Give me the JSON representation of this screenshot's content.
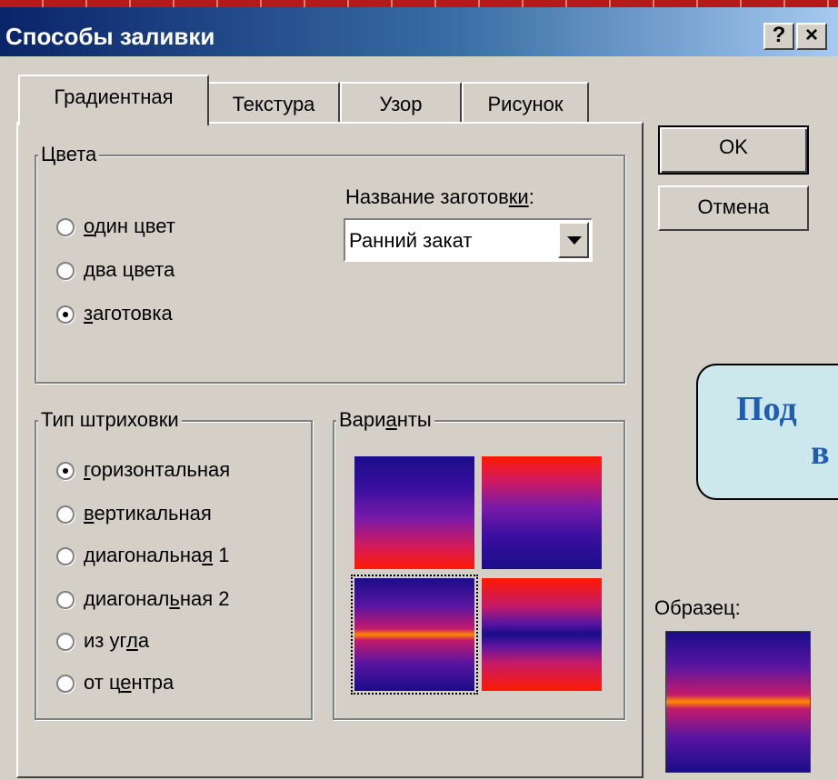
{
  "window": {
    "title": "Способы заливки",
    "help_label": "?",
    "close_label": "×"
  },
  "tabs": [
    {
      "label": "Градиентная",
      "active": true
    },
    {
      "label": "Текстура",
      "active": false
    },
    {
      "label": "Узор",
      "active": false
    },
    {
      "label": "Рисунок",
      "active": false
    }
  ],
  "colors_group": {
    "legend": "Цвета",
    "options": [
      {
        "pre": "",
        "u": "о",
        "post": "дин цвет",
        "checked": false
      },
      {
        "pre": "",
        "u": "д",
        "post": "ва цвета",
        "checked": false
      },
      {
        "pre": "",
        "u": "з",
        "post": "аготовка",
        "checked": true
      }
    ],
    "preset_label_pre": "Название заготов",
    "preset_label_u": "ки",
    "preset_label_post": ":",
    "preset_value": "Ранний закат"
  },
  "hatch_group": {
    "legend": "Тип штриховки",
    "options": [
      {
        "pre": "",
        "u": "г",
        "post": "оризонтальная",
        "checked": true
      },
      {
        "pre": "",
        "u": "в",
        "post": "ертикальная",
        "checked": false
      },
      {
        "pre": "диагональна",
        "u": "я",
        "post": " 1",
        "checked": false
      },
      {
        "pre": "диагонал",
        "u": "ь",
        "post": "ная 2",
        "checked": false
      },
      {
        "pre": "из уг",
        "u": "л",
        "post": "а",
        "checked": false
      },
      {
        "pre": "от ц",
        "u": "е",
        "post": "нтра",
        "checked": false
      }
    ]
  },
  "variants_group": {
    "legend_pre": "Вари",
    "legend_u": "а",
    "legend_post": "нты"
  },
  "buttons": {
    "ok": "OK",
    "cancel": "Отмена"
  },
  "sample_label": "Образец:",
  "callout": {
    "line1": "Под",
    "line2": "в"
  },
  "colors": {
    "titlebar_start": "#0a246a",
    "dialog_bg": "#d4d0c8",
    "callout_bg": "#cce8ec",
    "callout_text": "#1f5db0"
  }
}
